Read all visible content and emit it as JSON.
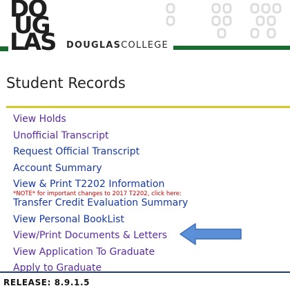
{
  "header": {
    "logo_lines": [
      "DO",
      "UG",
      "LAS"
    ],
    "wordmark_bold": "DOUGLAS",
    "wordmark_light": "COLLEGE",
    "colors": {
      "green": "#1a6b2e",
      "logo_black": "#1f1f1f"
    }
  },
  "page": {
    "title": "Student Records",
    "rule_color": "#d4c829"
  },
  "menu": {
    "items": [
      {
        "label": "View Holds"
      },
      {
        "label": "Unofficial Transcript"
      },
      {
        "label": "Request Official Transcript"
      },
      {
        "label": "Account Summary"
      },
      {
        "label": "View & Print T2202 Information"
      },
      {
        "label": "Transfer Credit Evaluation Summary"
      },
      {
        "label": "View Personal BookList"
      },
      {
        "label": "View/Print Documents & Letters"
      },
      {
        "label": "View Application To Graduate"
      },
      {
        "label": "Apply to Graduate"
      }
    ],
    "t2202_note": {
      "text": "*NOTE* for important changes to 2017 T2202, click ",
      "link": "here:"
    },
    "colors": {
      "visited": "#5a2aa0",
      "link": "#1638a8",
      "note": "#cc0000"
    }
  },
  "annotation": {
    "icon": "left-arrow-icon",
    "fill_color": "#5b8fd6",
    "stroke_color": "#3d6fb8"
  },
  "footer": {
    "release": "RELEASE: 8.9.1.5"
  }
}
